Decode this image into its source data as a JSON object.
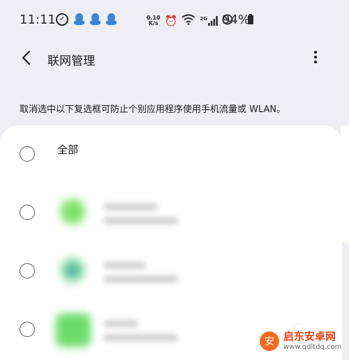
{
  "status_bar": {
    "time": "11:11",
    "net_speed_value": "0.10",
    "net_speed_unit": "K/s",
    "network_type": "2G",
    "battery": "94%"
  },
  "app_bar": {
    "title": "联网管理"
  },
  "description": "取消选中以下复选框可防止个别应用程序使用手机流量或 WLAN。",
  "list": {
    "all_label": "全部"
  },
  "watermark": {
    "brand": "启东安卓网",
    "url": "www.qdltdq.com",
    "logo_glyph": "安"
  },
  "icons": [
    "check-icon",
    "qq-icon",
    "alarm-icon",
    "wifi-icon",
    "signal-icon",
    "dnd-icon",
    "battery-icon",
    "back-arrow-icon",
    "more-vert-icon"
  ],
  "colors": {
    "background": "#eeeef4",
    "card": "#ffffff",
    "qq_blue": "#3a86d6",
    "app_green": "#7ee36a"
  }
}
